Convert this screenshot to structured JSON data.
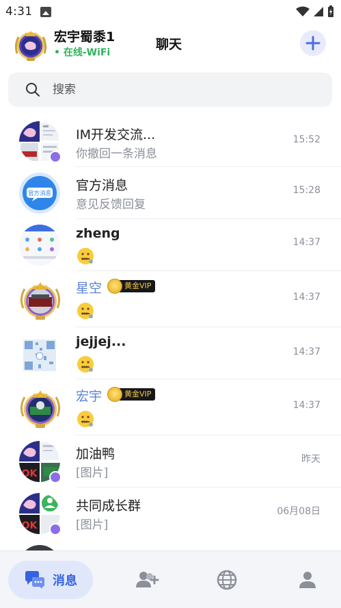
{
  "status_bar": {
    "time": "4:31"
  },
  "header": {
    "user_name": "宏宇蜀黍1",
    "status": "• 在线-WiFi",
    "title": "聊天"
  },
  "search": {
    "placeholder": "搜索"
  },
  "conversations": [
    {
      "title": "IM开发交流...",
      "subtitle": "你撤回一条消息",
      "time": "15:52",
      "type": "group"
    },
    {
      "title": "官方消息",
      "subtitle": "意见反馈回复",
      "time": "15:28",
      "type": "official",
      "avatar_text": "官方消息"
    },
    {
      "title": "zheng",
      "time": "14:37",
      "type": "user"
    },
    {
      "title": "星空",
      "time": "14:37",
      "type": "vip",
      "vip_label": "黄金VIP"
    },
    {
      "title": "jejjej...",
      "time": "14:37",
      "type": "user"
    },
    {
      "title": "宏宇",
      "time": "14:37",
      "type": "vip",
      "vip_label": "黄金VIP"
    },
    {
      "title": "加油鸭",
      "subtitle": "[图片]",
      "time": "昨天",
      "type": "group"
    },
    {
      "title": "共同成长群",
      "subtitle": "[图片]",
      "time": "06月08日",
      "type": "group"
    }
  ],
  "bottom_nav": {
    "active_label": "消息"
  },
  "colors": {
    "accent": "#3563e0",
    "online": "#2fb35a",
    "vip_name": "#5a83d6"
  }
}
